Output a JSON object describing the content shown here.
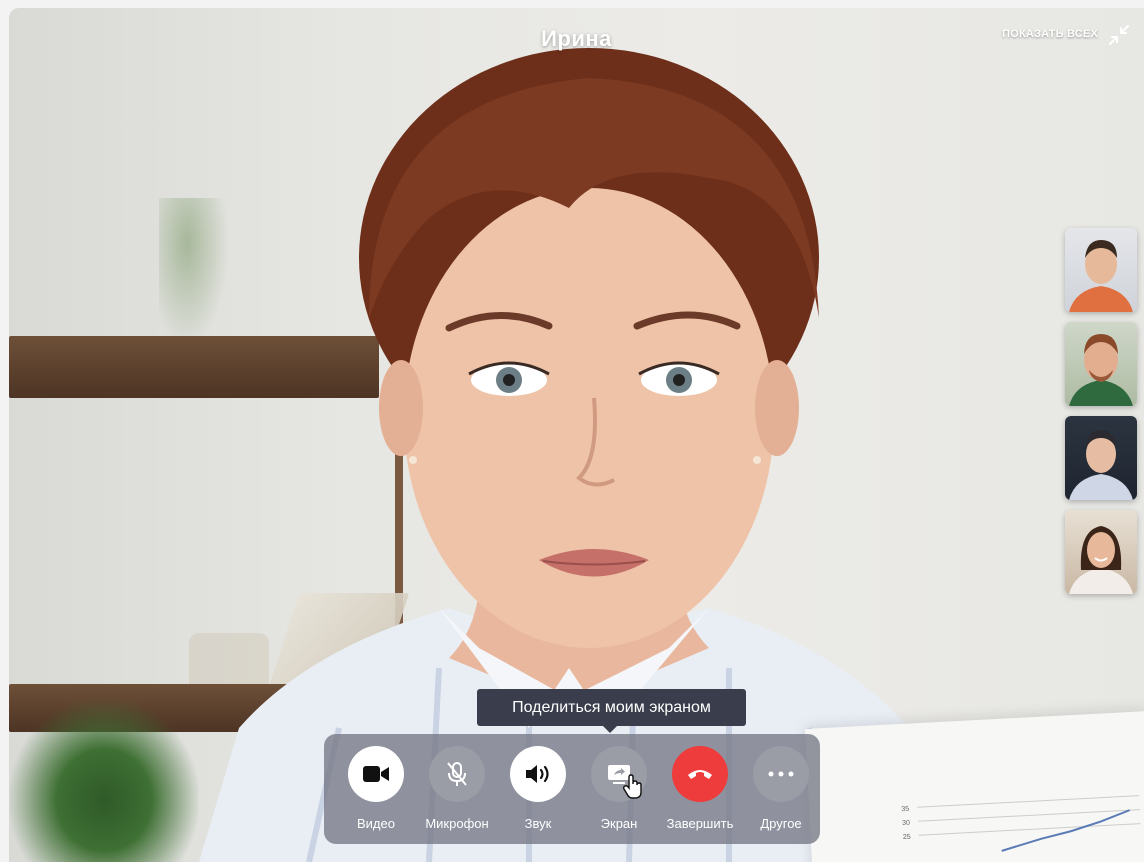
{
  "call": {
    "participant_name": "Ирина",
    "show_all_label": "ПОКАЗАТЬ ВСЕХ"
  },
  "tooltip": {
    "text": "Поделиться моим экраном"
  },
  "controls": [
    {
      "id": "video",
      "label": "Видео",
      "icon": "video-camera-icon"
    },
    {
      "id": "mic",
      "label": "Микрофон",
      "icon": "microphone-muted-icon"
    },
    {
      "id": "sound",
      "label": "Звук",
      "icon": "speaker-icon"
    },
    {
      "id": "screen",
      "label": "Экран",
      "icon": "screen-share-icon"
    },
    {
      "id": "end",
      "label": "Завершить",
      "icon": "hang-up-icon"
    },
    {
      "id": "more",
      "label": "Другое",
      "icon": "more-dots-icon"
    }
  ],
  "participants_thumbnails": [
    {
      "id": "p1",
      "shirt": "#e07040",
      "hair": "#3a2a20"
    },
    {
      "id": "p2",
      "shirt": "#2f6a3e",
      "hair": "#8a4a2a"
    },
    {
      "id": "p3",
      "shirt": "#cfd6e6",
      "hair": "#2a2a30"
    },
    {
      "id": "p4",
      "shirt": "#f2ede8",
      "hair": "#3b2418"
    }
  ],
  "paper_chart_ticks": [
    "35",
    "30",
    "25"
  ],
  "colors": {
    "end_call": "#ee3b3b",
    "tooltip_bg": "#3a3d4b",
    "control_bar": "#767885"
  }
}
